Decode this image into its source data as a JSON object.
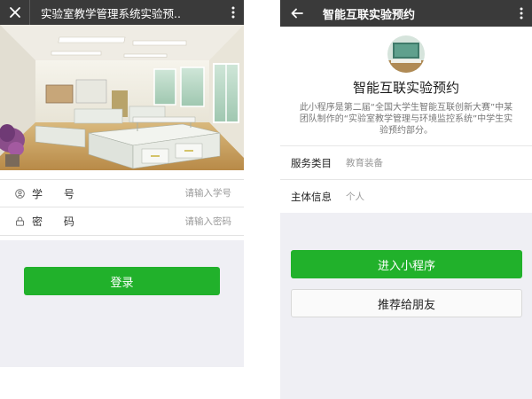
{
  "left": {
    "nav": {
      "title": "实验室教学管理系统实验预.."
    },
    "photo": {
      "label": "laboratory-photo"
    },
    "form": {
      "student_id": {
        "label": "学 号",
        "placeholder": "请输入学号"
      },
      "password": {
        "label": "密 码",
        "placeholder": "请输入密码"
      }
    },
    "login_label": "登录"
  },
  "right": {
    "nav": {
      "title": "智能互联实验预约"
    },
    "app": {
      "name": "智能互联实验预约",
      "description": "此小程序是第二届“全国大学生智能互联创新大赛”中某团队制作的“实验室教学管理与环境监控系统”中学生实验预约部分。"
    },
    "meta": [
      {
        "key": "服务类目",
        "value": "教育装备"
      },
      {
        "key": "主体信息",
        "value": "个人"
      }
    ],
    "enter_label": "进入小程序",
    "share_label": "推荐给朋友"
  },
  "colors": {
    "nav": "#3a3a3a",
    "accent": "#21b12b",
    "page_bg": "#efeff4"
  }
}
